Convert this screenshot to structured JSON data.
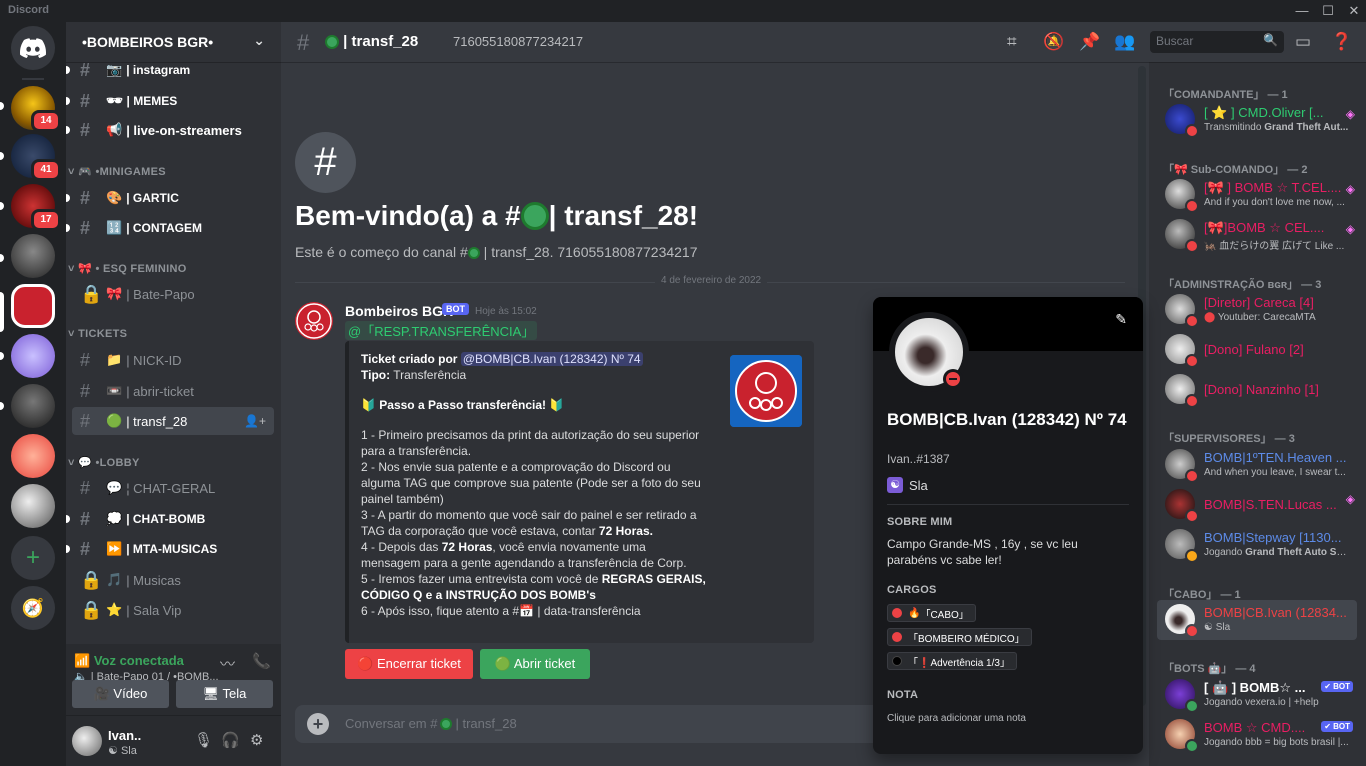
{
  "app": {
    "title": "Discord",
    "colors": {
      "accent": "#5865f2",
      "green": "#3ba55d",
      "red": "#ed4245",
      "pink": "#e91e63",
      "blue": "#5d8be8"
    }
  },
  "window": {
    "minimize": "—",
    "maximize": "☐",
    "close": "✕"
  },
  "rail": {
    "badges": [
      "14",
      "41",
      "17"
    ],
    "add_icon": "+",
    "explore_icon": "compass"
  },
  "guild": {
    "name": "•BOMBEIROS BGR•",
    "chevron": "⌄"
  },
  "channels": [
    {
      "name": "| instagram",
      "icon": "📷",
      "type": "text"
    },
    {
      "name": "| MEMES",
      "icon": "🕶",
      "type": "text"
    },
    {
      "name": "| live-on-streamers",
      "icon": "📢",
      "type": "text"
    },
    {
      "name": "| GARTIC",
      "icon": "🎨",
      "type": "text"
    },
    {
      "name": "| CONTAGEM",
      "icon": "🔢",
      "type": "text"
    },
    {
      "name": "| Bate-Papo",
      "icon": "🎀",
      "type": "locked"
    },
    {
      "name": "| NICK-ID",
      "icon": "📁",
      "type": "text"
    },
    {
      "name": "| abrir-ticket",
      "icon": "📼",
      "type": "text"
    },
    {
      "name": "| transf_28",
      "icon": "🟢",
      "type": "text"
    },
    {
      "name": "¦ CHAT-GERAL",
      "icon": "💬",
      "type": "text"
    },
    {
      "name": "| CHAT-BOMB",
      "icon": "💭",
      "type": "text"
    },
    {
      "name": "| MTA-MUSICAS",
      "icon": "⏩",
      "type": "text"
    },
    {
      "name": "| Musicas",
      "icon": "🎵",
      "type": "locked"
    },
    {
      "name": "| Sala Vip",
      "icon": "⭐",
      "type": "locked"
    }
  ],
  "categories": [
    "•MINIGAMES",
    "• ESQ FEMININO",
    "TICKETS",
    "•LOBBY"
  ],
  "voice": {
    "status": "Voz conectada",
    "location": "| Bate-Papo 01 / •BOMB...",
    "video": "Vídeo",
    "screen": "Tela"
  },
  "user": {
    "name": "Ivan..",
    "status": "Sla"
  },
  "topbar": {
    "channel": "| transf_28",
    "topic": "716055180877234217",
    "search_placeholder": "Buscar"
  },
  "welcome": {
    "heading_prefix": "Bem-vindo(a) a #",
    "heading_suffix": " | transf_28!",
    "sub_prefix": "Este é o começo do canal #",
    "sub_suffix": " | transf_28. 716055180877234217"
  },
  "date_divider": "4 de fevereiro de 2022",
  "message": {
    "author": "Bombeiros BGR",
    "bot_tag": "BOT",
    "time": "Hoje às 15:02",
    "mention": "@「RESP.TRANSFERÊNCIA」",
    "embed": {
      "created_label": "Ticket criado por",
      "created_user": "@BOMB|CB.Ivan (128342) Nº 74",
      "type_label": "Tipo:",
      "type_value": "Transferência",
      "step_title": "🔰 Passo a Passo transferência! 🔰",
      "step1": "1 - Primeiro precisamos da print da autorização do seu superior para a transferência.",
      "step2": "2 - Nos envie sua patente e a comprovação do Discord ou alguma TAG que comprove sua patente (Pode ser a foto do seu painel também)",
      "step3_a": "3 - A partir do momento que você sair do painel e ser retirado a TAG da corporação que você estava, contar ",
      "step3_b": "72 Horas.",
      "step4_a": "4 - Depois das ",
      "step4_b": "72 Horas",
      "step4_c": ", você envia novamente uma mensagem para a gente agendando a transferência de Corp.",
      "step5_a": "5 - Iremos fazer uma entrevista com você de ",
      "step5_b": "REGRAS GERAIS, CÓDIGO Q e a INSTRUÇÃO DOS BOMB's",
      "step6_a": "6 - Após isso, fique atento a #",
      "step6_b": " | data-transferência"
    },
    "btn_close": "Encerrar ticket",
    "btn_open": "Abrir ticket"
  },
  "composer": {
    "placeholder_prefix": "Conversar em #",
    "placeholder_suffix": " | transf_28"
  },
  "profile": {
    "name": "BOMB|CB.Ivan (128342) Nº 74",
    "tag": "Ivan..#1387",
    "custom_status": "Sla",
    "about_label": "SOBRE MIM",
    "about": "Campo Grande-MS , 16y , se vc leu parabéns vc sabe ler!",
    "roles_label": "CARGOS",
    "roles": [
      {
        "name": "「CABO」",
        "color": "#ed4245",
        "emoji": "🔥"
      },
      {
        "name": "「BOMBEIRO MÉDICO」",
        "color": "#ed4245",
        "emoji": ""
      },
      {
        "name": "「❗Advertência 1/3」",
        "color": "#111111",
        "emoji": ""
      }
    ],
    "note_label": "NOTA",
    "note": "Clique para adicionar uma nota"
  },
  "members": {
    "groups": [
      {
        "title": "「COMANDANTE」 — 1",
        "items": [
          {
            "name": "[ ⭐ ] CMD.Oliver [...",
            "sub_prefix": "Transmitindo ",
            "sub_bold": "Grand Theft Aut...",
            "color": "#2ecc71",
            "boost": true
          }
        ]
      },
      {
        "title": "「🎀 Sub-COMANDO」 — 2",
        "items": [
          {
            "name": "[🎀 ] BOMB ☆ T.CEL....",
            "sub": "And if you don't love me now, ...",
            "color": "#e91e63",
            "boost": true
          },
          {
            "name": "[🎀]BOMB ☆ CEL....",
            "sub": "🦗 血だらけの翼 広げて Like ...",
            "color": "#e91e63",
            "boost": true
          }
        ]
      },
      {
        "title": "「ADMINSTRAÇÃO ʙɢʀ」 — 3",
        "items": [
          {
            "name": "[Diretor] Careca [4]",
            "sub": "Youtuber: CarecaMTA",
            "color": "#e91e63"
          },
          {
            "name": "[Dono] Fulano [2]",
            "sub": "",
            "color": "#e91e63"
          },
          {
            "name": "[Dono] Nanzinho [1]",
            "sub": "",
            "color": "#e91e63"
          }
        ]
      },
      {
        "title": "「SUPERVISORES」 — 3",
        "items": [
          {
            "name": "BOMB|1ºTEN.Heaven ...",
            "sub": "And when you leave, I swear t...",
            "color": "#5d8be8"
          },
          {
            "name": "BOMB|S.TEN.Lucas ...",
            "sub": "",
            "color": "#e91e63",
            "boost": true
          },
          {
            "name": "BOMB|Stepway [1130...",
            "sub_prefix": "Jogando ",
            "sub_bold": "Grand Theft Auto Sa...",
            "color": "#5d8be8"
          }
        ]
      },
      {
        "title": "「CABO」 — 1",
        "items": [
          {
            "name": "BOMB|CB.Ivan (12834...",
            "sub": "Sla",
            "color": "#ed4245"
          }
        ]
      },
      {
        "title": "「BOTS 🤖」 — 4",
        "items": [
          {
            "name": "[ 🤖 ] BOMB☆ ...",
            "sub": "Jogando vexera.io | +help",
            "color": "#ffffff",
            "bot": "✔ BOT"
          },
          {
            "name": "BOMB ☆ CMD....",
            "sub": "Jogando bbb = big bots brasil |...",
            "color": "#e91e63",
            "bot": "✔ BOT"
          }
        ]
      }
    ]
  }
}
